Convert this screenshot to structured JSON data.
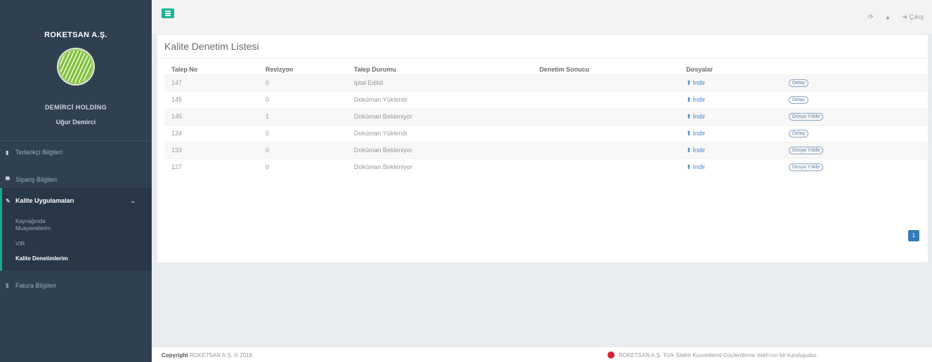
{
  "sidebar": {
    "company": "ROKETSAN A.Ş.",
    "org": "DEMİRCİ HOLDİNG",
    "user": "Uğur Demirci",
    "items": [
      {
        "label": "Tedarikçi Bilgileri",
        "icon": "bar-chart-icon"
      },
      {
        "label": "Sipariş Bilgileri",
        "icon": "cart-icon"
      },
      {
        "label": "Kalite Uygulamaları",
        "icon": "wrench-icon"
      },
      {
        "label": "Fatura Bilgileri",
        "icon": "dollar-icon"
      }
    ],
    "sub_items": [
      "Kaynağında Muayenelerim",
      "VIR",
      "Kalite Denetimlerim"
    ]
  },
  "topbar": {
    "logout_label": "Çıkış"
  },
  "page": {
    "title": "Kalite Denetim Listesi"
  },
  "table": {
    "headers": [
      "Talep No",
      "Revizyon",
      "Talep Durumu",
      "Denetim Sonucu",
      "Dosyalar",
      ""
    ],
    "rows": [
      {
        "talep_no": "147",
        "revizyon": "0",
        "durum": "İptal Edildi",
        "sonuc": "",
        "dosya": "İndir",
        "action": "Detay"
      },
      {
        "talep_no": "145",
        "revizyon": "0",
        "durum": "Doküman Yüklendi",
        "sonuc": "",
        "dosya": "İndir",
        "action": "Detay"
      },
      {
        "talep_no": "145",
        "revizyon": "1",
        "durum": "Doküman Bekleniyor",
        "sonuc": "",
        "dosya": "İndir",
        "action": "Dosya Yükle"
      },
      {
        "talep_no": "134",
        "revizyon": "0",
        "durum": "Doküman Yüklendi",
        "sonuc": "",
        "dosya": "İndir",
        "action": "Detay"
      },
      {
        "talep_no": "133",
        "revizyon": "0",
        "durum": "Doküman Bekleniyor",
        "sonuc": "",
        "dosya": "İndir",
        "action": "Dosya Yükle"
      },
      {
        "talep_no": "127",
        "revizyon": "0",
        "durum": "Doküman Bekleniyor",
        "sonuc": "",
        "dosya": "İndir",
        "action": "Dosya Yükle"
      }
    ]
  },
  "pagination": {
    "current": "1"
  },
  "footer": {
    "copyright_label": "Copyright",
    "copyright_text": "ROKETSAN A.Ş. © 2018",
    "info": "ROKETSAN A.Ş. Türk Silahlı Kuvvetlerini Güçlendirme Vakfı'nın bir kuruluşudur."
  }
}
